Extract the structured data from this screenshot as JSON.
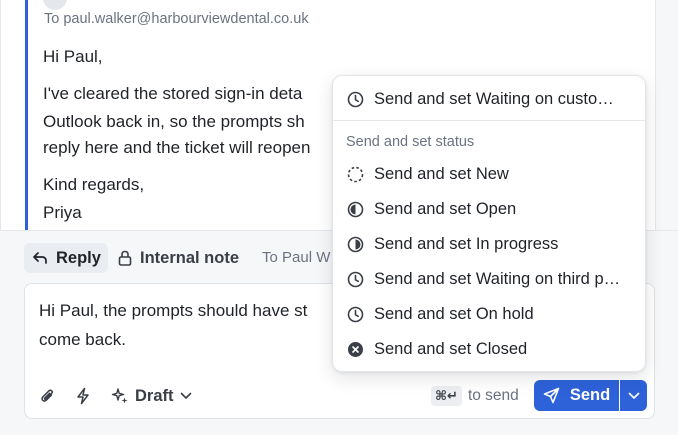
{
  "email": {
    "to_line": "To paul.walker@harbourviewdental.co.uk",
    "greeting": "Hi Paul,",
    "body_line1": "I've cleared the stored sign-in deta",
    "body_line2": "Outlook back in, so the prompts sh",
    "body_line3": "reply here and the ticket will reopen",
    "closing": "Kind regards,",
    "signature": "Priya"
  },
  "composer": {
    "tabs": {
      "reply": "Reply",
      "internal_note": "Internal note"
    },
    "to_short": "To Paul W",
    "draft_text": "Hi Paul, the prompts should have st… come back.",
    "draft_line1": "Hi Paul, the prompts should have st",
    "draft_line2": "come back.",
    "draft_button": "Draft",
    "shortcut_keys": "⌘↵",
    "shortcut_hint": "to send",
    "send_label": "Send"
  },
  "send_menu": {
    "top_item": "Send and set Waiting on custo…",
    "section_heading": "Send and set status",
    "items": [
      {
        "label": "Send and set New",
        "icon": "status-new-icon"
      },
      {
        "label": "Send and set Open",
        "icon": "status-open-icon"
      },
      {
        "label": "Send and set In progress",
        "icon": "status-in-progress-icon"
      },
      {
        "label": "Send and set Waiting on third p…",
        "icon": "clock-icon"
      },
      {
        "label": "Send and set On hold",
        "icon": "clock-icon"
      },
      {
        "label": "Send and set Closed",
        "icon": "status-closed-icon"
      }
    ]
  },
  "colors": {
    "accent": "#2e62d9",
    "text": "#1f2328",
    "muted": "#6b7280"
  }
}
